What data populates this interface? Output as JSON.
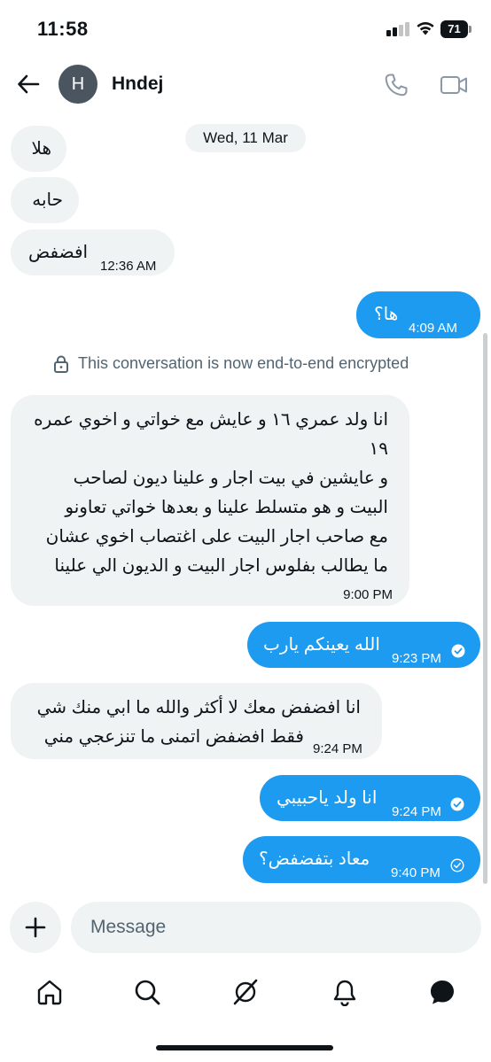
{
  "status_bar": {
    "time": "11:58",
    "battery": "71"
  },
  "header": {
    "avatar_initial": "H",
    "name": "Hndej"
  },
  "date_separator": "Wed, 11 Mar",
  "encryption_notice": "This conversation is now end-to-end encrypted",
  "messages": [
    {
      "direction": "incoming",
      "text": "هلا"
    },
    {
      "direction": "incoming",
      "text": "حابه"
    },
    {
      "direction": "incoming",
      "text": "افضفض",
      "time": "12:36 AM"
    },
    {
      "direction": "outgoing",
      "text": "ها؟",
      "time": "4:09 AM"
    },
    {
      "direction": "incoming",
      "lines": [
        "انا ولد عمري ١٦ و عايش مع خواتي و اخوي عمره",
        "١٩",
        "و عايشين في بيت اجار و علينا ديون لصاحب",
        "البيت و هو متسلط علينا و بعدها خواتي تعاونو",
        "مع صاحب اجار البيت على اغتصاب اخوي عشان",
        "ما يطالب بفلوس اجار البيت و الديون الي علينا"
      ],
      "time": "9:00 PM"
    },
    {
      "direction": "outgoing",
      "text": "الله يعينكم يارب",
      "time": "9:23 PM",
      "status": "read"
    },
    {
      "direction": "incoming",
      "lines": [
        "انا افضفض معك لا أكثر والله ما ابي منك شي",
        "فقط افضفض اتمنى ما تنزعجي مني"
      ],
      "time": "9:24 PM"
    },
    {
      "direction": "outgoing",
      "text": "انا ولد ياحبيبي",
      "time": "9:24 PM",
      "status": "read"
    },
    {
      "direction": "outgoing",
      "text": "معاد بتفضفض؟",
      "time": "9:40 PM",
      "status": "sent"
    }
  ],
  "composer": {
    "placeholder": "Message"
  },
  "icons": {
    "back": "arrow-left-icon",
    "call": "phone-icon",
    "video": "video-camera-icon",
    "lock": "lock-icon",
    "add": "plus-icon",
    "nav": [
      "home-icon",
      "search-icon",
      "grok-icon",
      "bell-icon",
      "messages-icon"
    ]
  },
  "colors": {
    "accent": "#1d9bf0",
    "incoming_bubble": "#eff3f4",
    "text": "#0f1419",
    "muted": "#536471"
  }
}
